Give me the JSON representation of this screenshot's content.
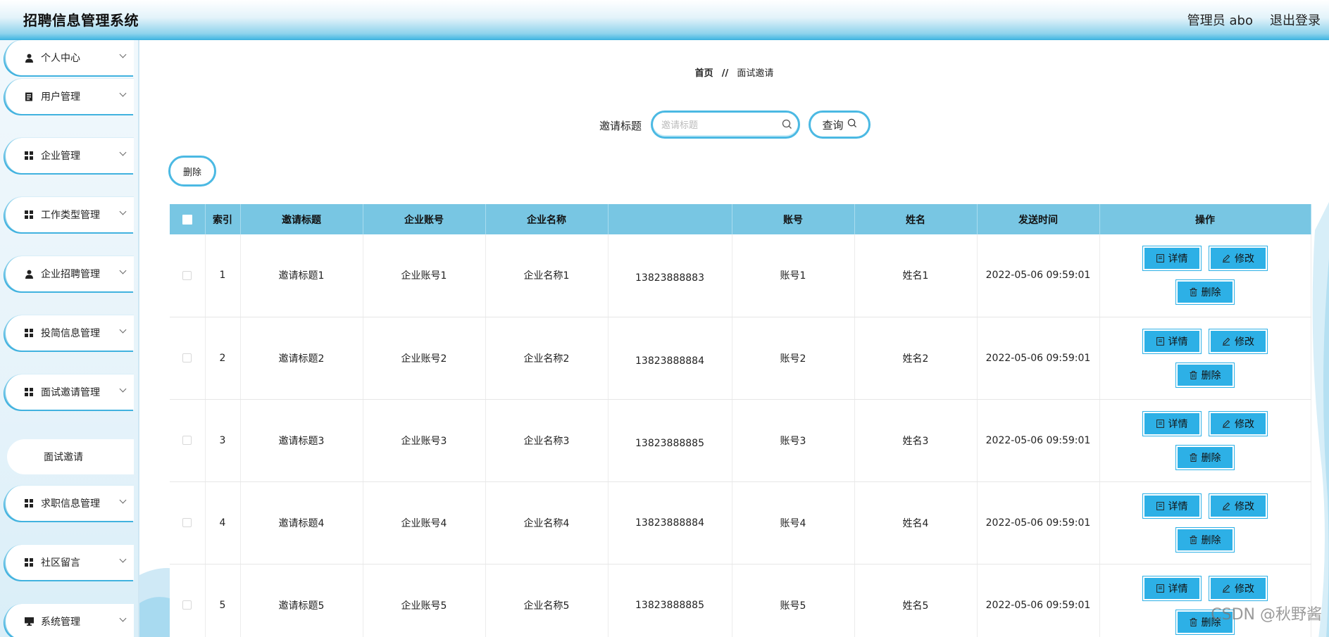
{
  "header": {
    "title": "招聘信息管理系统",
    "admin_label": "管理员 abo",
    "logout_label": "退出登录"
  },
  "sidebar": {
    "items": [
      {
        "label": "个人中心",
        "icon": "user-icon"
      },
      {
        "label": "用户管理",
        "icon": "document-icon"
      },
      {
        "label": "企业管理",
        "icon": "grid-icon"
      },
      {
        "label": "工作类型管理",
        "icon": "grid-icon"
      },
      {
        "label": "企业招聘管理",
        "icon": "user-icon"
      },
      {
        "label": "投简信息管理",
        "icon": "grid-icon"
      },
      {
        "label": "面试邀请管理",
        "icon": "grid-icon"
      },
      {
        "label": "求职信息管理",
        "icon": "grid-icon"
      },
      {
        "label": "社区留言",
        "icon": "grid-icon"
      },
      {
        "label": "系统管理",
        "icon": "monitor-icon"
      }
    ],
    "sub_item": "面试邀请"
  },
  "breadcrumb": {
    "home": "首页",
    "separator": "//",
    "current": "面试邀请"
  },
  "search": {
    "label": "邀请标题",
    "placeholder": "邀请标题",
    "value": "",
    "button": "查询"
  },
  "toolbar": {
    "delete_label": "删除"
  },
  "table": {
    "headers": [
      "索引",
      "邀请标题",
      "企业账号",
      "企业名称",
      "",
      "账号",
      "姓名",
      "发送时间",
      "操作"
    ],
    "rows": [
      {
        "index": "1",
        "title": "邀请标题1",
        "company_account": "企业账号1",
        "company_name": "企业名称1",
        "phone": "13823888883",
        "account": "账号1",
        "name": "姓名1",
        "time": "2022-05-06 09:59:01"
      },
      {
        "index": "2",
        "title": "邀请标题2",
        "company_account": "企业账号2",
        "company_name": "企业名称2",
        "phone": "13823888884",
        "account": "账号2",
        "name": "姓名2",
        "time": "2022-05-06 09:59:01"
      },
      {
        "index": "3",
        "title": "邀请标题3",
        "company_account": "企业账号3",
        "company_name": "企业名称3",
        "phone": "13823888885",
        "account": "账号3",
        "name": "姓名3",
        "time": "2022-05-06 09:59:01"
      },
      {
        "index": "4",
        "title": "邀请标题4",
        "company_account": "企业账号4",
        "company_name": "企业名称4",
        "phone": "13823888884",
        "account": "账号4",
        "name": "姓名4",
        "time": "2022-05-06 09:59:01"
      },
      {
        "index": "5",
        "title": "邀请标题5",
        "company_account": "企业账号5",
        "company_name": "企业名称5",
        "phone": "13823888885",
        "account": "账号5",
        "name": "姓名5",
        "time": "2022-05-06 09:59:01"
      }
    ],
    "actions": {
      "detail": "详情",
      "edit": "修改",
      "delete": "删除"
    }
  },
  "watermark": "CSDN @秋野酱",
  "colors": {
    "accent": "#2db0e6",
    "table_header": "#78c6e3",
    "border": "#4bb9e3"
  }
}
